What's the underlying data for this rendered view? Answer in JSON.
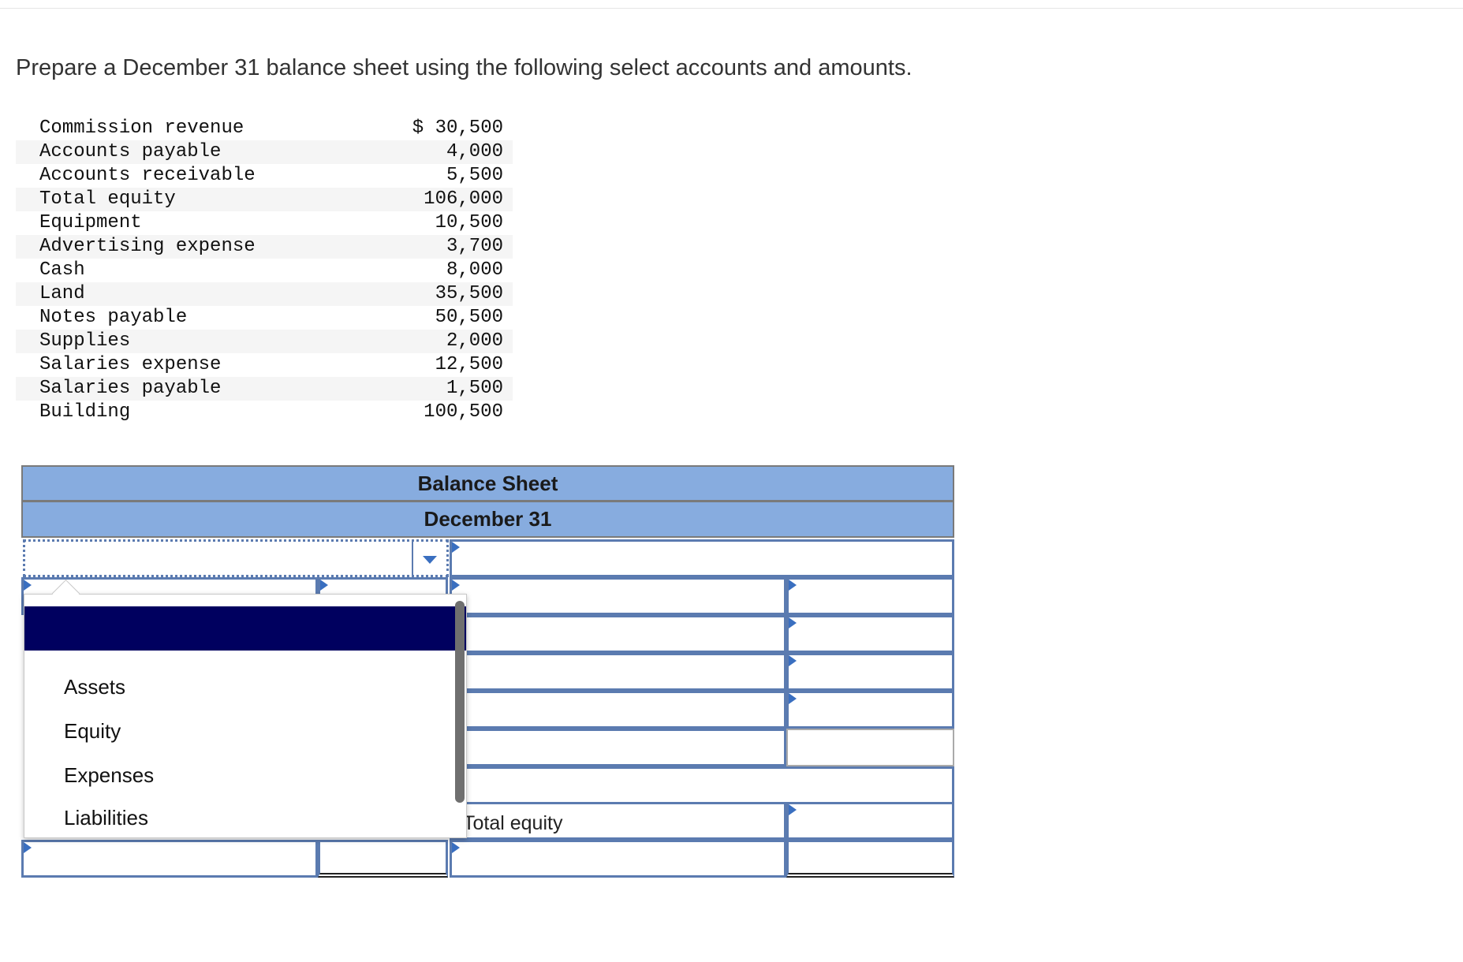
{
  "prompt": "Prepare a December 31 balance sheet using the following select accounts and amounts.",
  "accounts": [
    {
      "name": "Commission revenue",
      "amount": "$ 30,500"
    },
    {
      "name": "Accounts payable",
      "amount": "4,000"
    },
    {
      "name": "Accounts receivable",
      "amount": "5,500"
    },
    {
      "name": "Total equity",
      "amount": "106,000"
    },
    {
      "name": "Equipment",
      "amount": "10,500"
    },
    {
      "name": "Advertising expense",
      "amount": "3,700"
    },
    {
      "name": "Cash",
      "amount": "8,000"
    },
    {
      "name": "Land",
      "amount": "35,500"
    },
    {
      "name": "Notes payable",
      "amount": "50,500"
    },
    {
      "name": "Supplies",
      "amount": "2,000"
    },
    {
      "name": "Salaries expense",
      "amount": "12,500"
    },
    {
      "name": "Salaries payable",
      "amount": "1,500"
    },
    {
      "name": "Building",
      "amount": "100,500"
    }
  ],
  "balance_sheet": {
    "title": "Balance Sheet",
    "date": "December 31",
    "total_equity_label": "Total equity"
  },
  "dropdown": {
    "selected": "",
    "options": [
      "Assets",
      "Equity",
      "Expenses",
      "Liabilities"
    ]
  },
  "colors": {
    "header_bg": "#87acdf",
    "cell_border": "#5b7bb0",
    "selected_bg": "#00005f"
  }
}
